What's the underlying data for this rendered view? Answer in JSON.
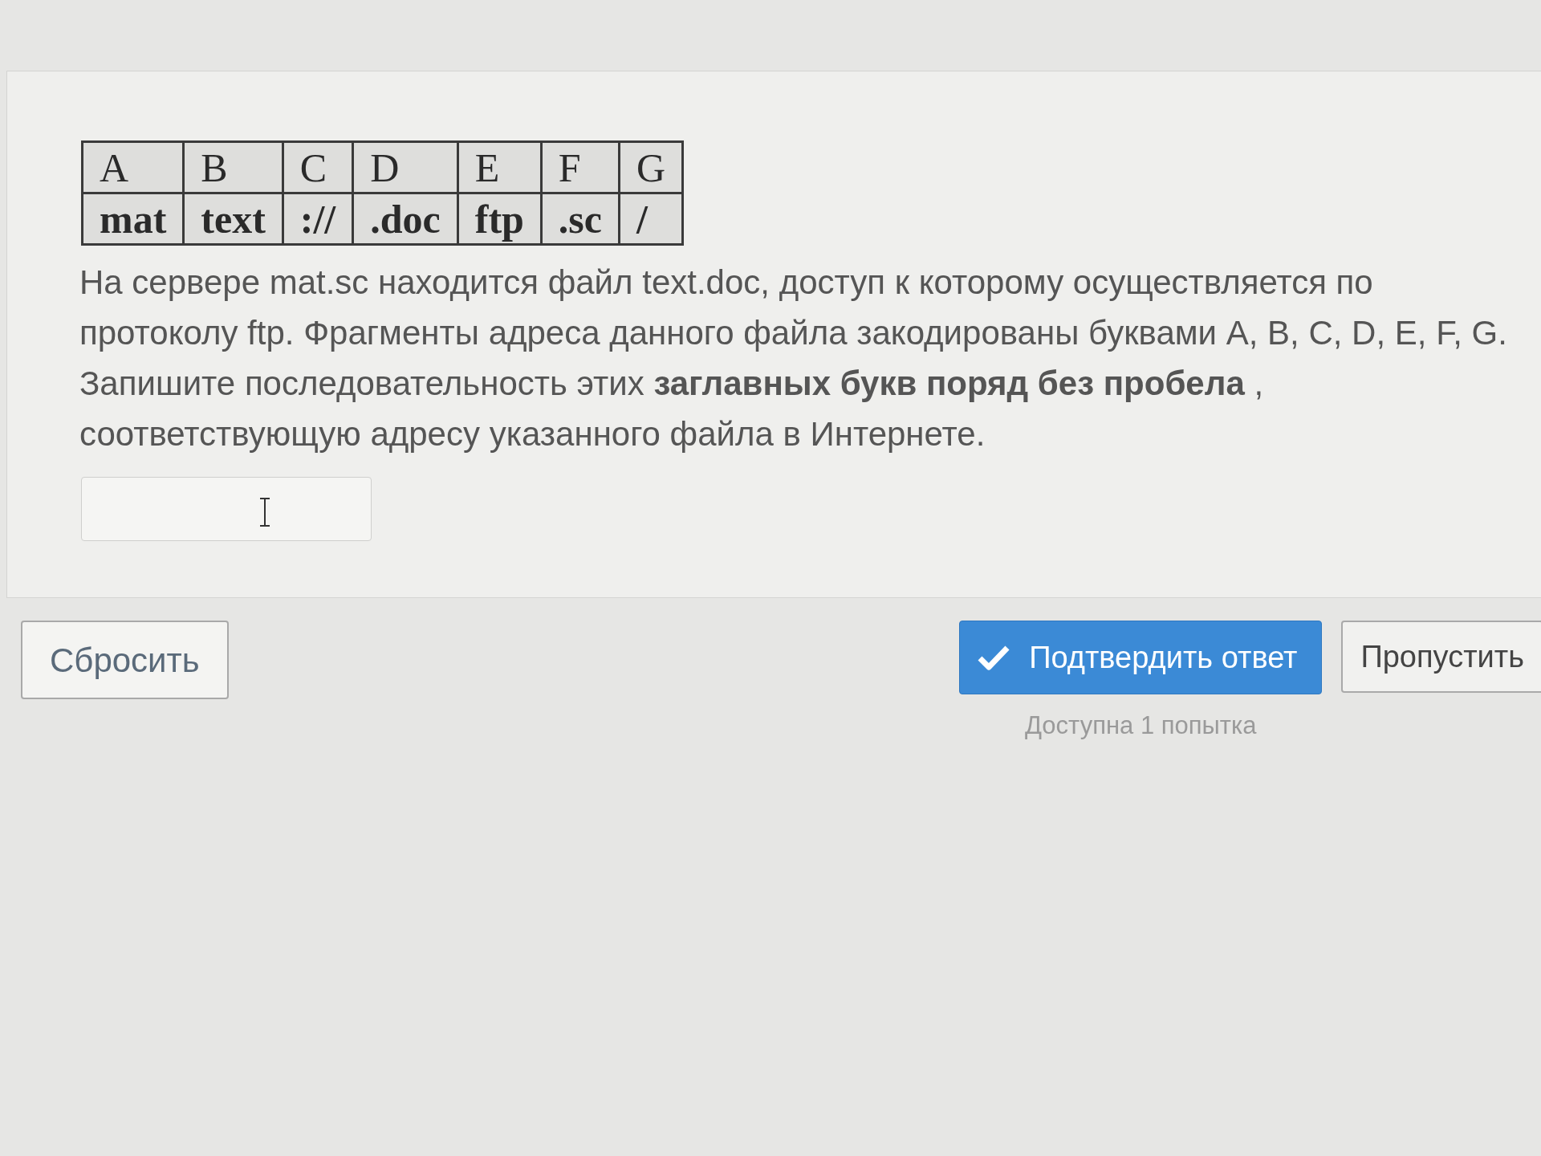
{
  "code_table": {
    "letters": [
      "A",
      "B",
      "C",
      "D",
      "E",
      "F",
      "G"
    ],
    "fragments": [
      "mat",
      "text",
      "://",
      ".doc",
      "ftp",
      ".sc",
      "/"
    ]
  },
  "question": "На сервере mat.sc находится файл text.doc, доступ к которому осуществляется по протоколу ftp. Фрагменты адреса данного файла закодированы буквами A, B, C, D, E, F, G. Запишите последовательность этих **заглавных букв поряд без пробела** , соответствующую адресу указанного файла в Интернете.",
  "buttons": [
    {
      "kind": "reset",
      "label": "Сбросить"
    },
    {
      "kind": "submit",
      "label": "Подтвердить ответ"
    },
    {
      "kind": "skip",
      "label": "Пропустить"
    }
  ],
  "attempts_note": "Доступна 1 попытка"
}
